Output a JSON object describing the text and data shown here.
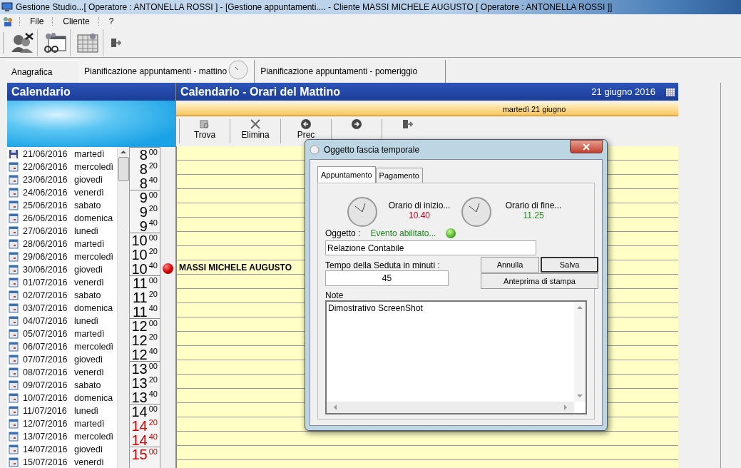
{
  "window": {
    "title": "Gestione Studio...[ Operatore : ANTONELLA ROSSI ] - [Gestione appuntamenti.... - Cliente  MASSI MICHELE AUGUSTO [ Operatore : ANTONELLA ROSSI ]]"
  },
  "menu": [
    "File",
    "Cliente",
    "?"
  ],
  "tabs": [
    {
      "label": "Anagrafica",
      "selected": false
    },
    {
      "label": "Pianificazione appuntamenti  - mattino",
      "selected": true
    },
    {
      "label": "Pianificazione appuntamenti - pomeriggio",
      "selected": false
    }
  ],
  "calendar": {
    "title": "Calendario",
    "dates": [
      {
        "date": "21/06/2016",
        "day": "martedì",
        "kind": "save"
      },
      {
        "date": "22/06/2016",
        "day": "mercoledì",
        "kind": "calendar"
      },
      {
        "date": "23/06/2016",
        "day": "giovedì",
        "kind": "calendar"
      },
      {
        "date": "24/06/2016",
        "day": "venerdì",
        "kind": "calendar"
      },
      {
        "date": "25/06/2016",
        "day": "sabato",
        "kind": "calendar"
      },
      {
        "date": "26/06/2016",
        "day": "domenica",
        "kind": "calendar"
      },
      {
        "date": "27/06/2016",
        "day": "lunedì",
        "kind": "calendar"
      },
      {
        "date": "28/06/2016",
        "day": "martedì",
        "kind": "calendar"
      },
      {
        "date": "29/06/2016",
        "day": "mercoledì",
        "kind": "calendar"
      },
      {
        "date": "30/06/2016",
        "day": "giovedì",
        "kind": "calendar"
      },
      {
        "date": "01/07/2016",
        "day": "venerdì",
        "kind": "calendar"
      },
      {
        "date": "02/07/2016",
        "day": "sabato",
        "kind": "calendar"
      },
      {
        "date": "03/07/2016",
        "day": "domenica",
        "kind": "calendar"
      },
      {
        "date": "04/07/2016",
        "day": "lunedì",
        "kind": "calendar"
      },
      {
        "date": "05/07/2016",
        "day": "martedì",
        "kind": "calendar"
      },
      {
        "date": "06/07/2016",
        "day": "mercoledì",
        "kind": "calendar"
      },
      {
        "date": "07/07/2016",
        "day": "giovedì",
        "kind": "calendar"
      },
      {
        "date": "08/07/2016",
        "day": "venerdì",
        "kind": "calendar"
      },
      {
        "date": "09/07/2016",
        "day": "sabato",
        "kind": "calendar"
      },
      {
        "date": "10/07/2016",
        "day": "domenica",
        "kind": "calendar"
      },
      {
        "date": "11/07/2016",
        "day": "lunedì",
        "kind": "calendar"
      },
      {
        "date": "12/07/2016",
        "day": "martedì",
        "kind": "calendar"
      },
      {
        "date": "13/07/2016",
        "day": "mercoledì",
        "kind": "calendar"
      },
      {
        "date": "14/07/2016",
        "day": "giovedì",
        "kind": "calendar"
      },
      {
        "date": "15/07/2016",
        "day": "venerdì",
        "kind": "calendar"
      }
    ]
  },
  "times": [
    {
      "hour": "8",
      "minute": "00",
      "color": "#000000"
    },
    {
      "hour": "8",
      "minute": "20",
      "color": "#000000"
    },
    {
      "hour": "8",
      "minute": "40",
      "color": "#000000"
    },
    {
      "hour": "9",
      "minute": "00",
      "color": "#000000"
    },
    {
      "hour": "9",
      "minute": "20",
      "color": "#000000"
    },
    {
      "hour": "9",
      "minute": "40",
      "color": "#000000"
    },
    {
      "hour": "10",
      "minute": "00",
      "color": "#000000"
    },
    {
      "hour": "10",
      "minute": "20",
      "color": "#000000"
    },
    {
      "hour": "10",
      "minute": "40",
      "color": "#000000",
      "appointment": "MASSI MICHELE AUGUSTO"
    },
    {
      "hour": "11",
      "minute": "00",
      "color": "#000000"
    },
    {
      "hour": "11",
      "minute": "20",
      "color": "#000000"
    },
    {
      "hour": "11",
      "minute": "40",
      "color": "#000000"
    },
    {
      "hour": "12",
      "minute": "00",
      "color": "#000000"
    },
    {
      "hour": "12",
      "minute": "20",
      "color": "#000000"
    },
    {
      "hour": "12",
      "minute": "40",
      "color": "#000000"
    },
    {
      "hour": "13",
      "minute": "00",
      "color": "#000000"
    },
    {
      "hour": "13",
      "minute": "20",
      "color": "#000000"
    },
    {
      "hour": "13",
      "minute": "40",
      "color": "#000000"
    },
    {
      "hour": "14",
      "minute": "00",
      "color": "#000000"
    },
    {
      "hour": "14",
      "minute": "20",
      "color": "#cc0000"
    },
    {
      "hour": "14",
      "minute": "40",
      "color": "#cc0000"
    },
    {
      "hour": "15",
      "minute": "00",
      "color": "#cc0000"
    }
  ],
  "schedule": {
    "title": "Calendario - Orari del Mattino",
    "date": "21 giugno 2016",
    "day_bar": "martedì 21 giugno",
    "tools": [
      {
        "label": "Trova",
        "kind": "search"
      },
      {
        "label": "Elimina",
        "kind": "delete"
      },
      {
        "label": "Prec",
        "kind": "prev"
      },
      {
        "kind": "next"
      },
      {
        "kind": "exit"
      }
    ]
  },
  "dialog": {
    "title": "Oggetto fascia temporale",
    "tabs": [
      {
        "label": "Appuntamento",
        "selected": true
      },
      {
        "label": "Pagamento",
        "selected": false
      }
    ],
    "start_label": "Orario di inizio...",
    "start_time": "10.40",
    "end_label": "Orario di fine...",
    "end_time": "11.25",
    "object_label": "Oggetto :",
    "status": "Evento abilitato...",
    "enabled": true,
    "object_value": "Relazione Contabile",
    "duration_label": "Tempo della Seduta in minuti :",
    "duration_value": "45",
    "cancel": "Annulla",
    "save": "Salva",
    "preview": "Anteprima di stampa",
    "notes_label": "Note",
    "notes": "Dimostrativo ScreenShot"
  }
}
